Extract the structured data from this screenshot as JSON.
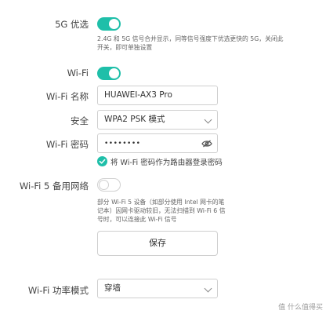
{
  "settings": {
    "fiveg_pref": {
      "label": "5G 优选",
      "enabled": true,
      "note": "2.4G 和 5G 信号合并显示，同等信号强度下优选更快的 5G，关闭此开关，即可单独设置"
    },
    "wifi": {
      "label": "Wi-Fi",
      "enabled": true
    },
    "wifi_name": {
      "label": "Wi-Fi 名称",
      "value": "HUAWEI-AX3 Pro"
    },
    "security": {
      "label": "安全",
      "value": "WPA2 PSK 模式"
    },
    "wifi_password": {
      "label": "Wi-Fi 密码",
      "value": "••••••••"
    },
    "use_as_admin": {
      "checked": true,
      "label": "将 Wi-Fi 密码作为路由器登录密码"
    },
    "wifi5_backup": {
      "label": "Wi-Fi 5 备用网络",
      "enabled": false,
      "note": "部分 Wi-Fi 5 设备（如部分使用 Intel 网卡的笔记本）因网卡驱动较旧，无法扫描到 Wi-Fi 6 信号时，可以连接此 Wi-Fi 信号"
    },
    "save_label": "保存",
    "power_mode": {
      "label": "Wi-Fi 功率模式",
      "value": "穿墙"
    }
  },
  "watermark": "值 什么值得买",
  "colors": {
    "accent": "#1fbfa9",
    "border": "#cfcfcf"
  }
}
